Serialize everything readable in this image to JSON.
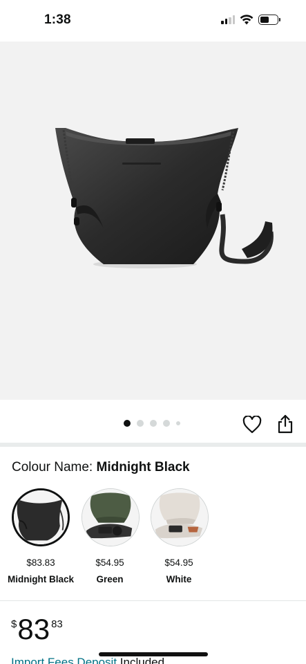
{
  "status_bar": {
    "time": "1:38"
  },
  "product": {
    "image_alt": "Midnight Black sling camera bag",
    "carousel": {
      "total_images": 5,
      "active_index": 0
    }
  },
  "colour": {
    "label": "Colour Name:",
    "selected": "Midnight Black",
    "options": [
      {
        "name": "Midnight Black",
        "price": "$83.83",
        "selected": true
      },
      {
        "name": "Green",
        "price": "$54.95",
        "selected": false
      },
      {
        "name": "White",
        "price": "$54.95",
        "selected": false
      }
    ]
  },
  "price": {
    "symbol": "$",
    "whole": "83",
    "fraction": "83"
  },
  "import": {
    "link_text": "Import Fees Deposit",
    "suffix": " Included"
  },
  "colors": {
    "link": "#007185",
    "text": "#0f1111",
    "image_bg": "#f2f2f2"
  }
}
